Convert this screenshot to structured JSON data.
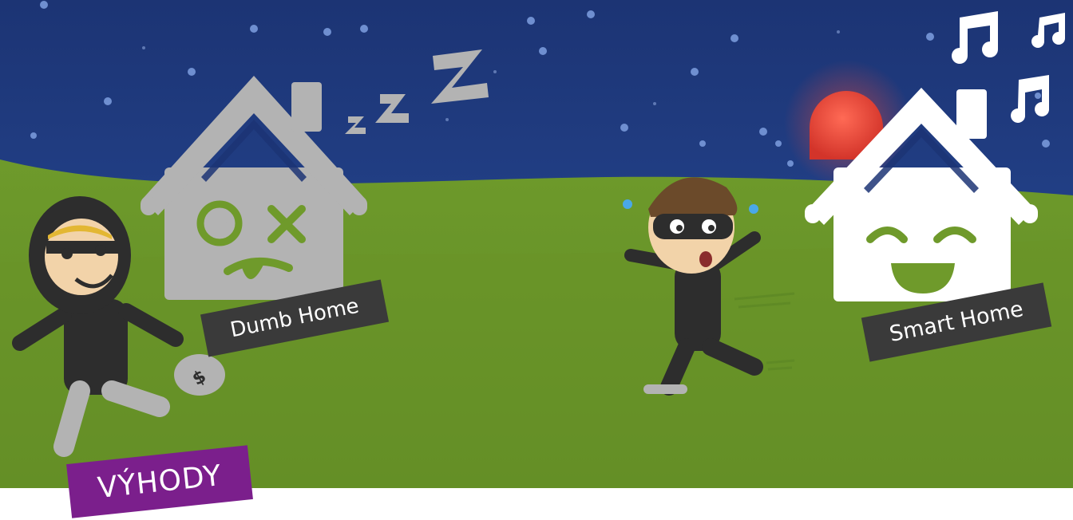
{
  "labels": {
    "dumb_home": "Dumb Home",
    "smart_home": "Smart Home",
    "section_title": "VÝHODY"
  },
  "icons": {
    "sleep": "zzz-icon",
    "music": "music-note-icon",
    "alarm": "alarm-light-icon",
    "money": "dollar-sign"
  },
  "colors": {
    "sky": "#1e3a7a",
    "grass": "#6f9a2a",
    "dumb_house": "#b3b3b3",
    "smart_house": "#ffffff",
    "label_bg": "#3a3a3a",
    "section_bg": "#7b1f8c",
    "alarm": "#e23a2e"
  }
}
